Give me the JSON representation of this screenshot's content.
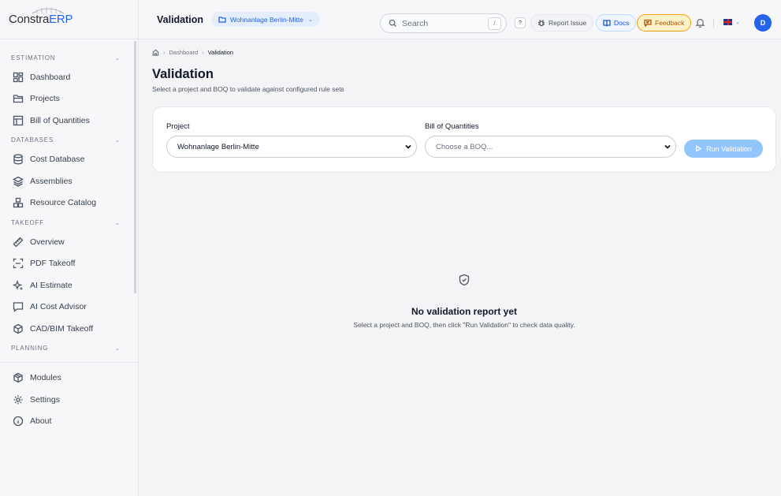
{
  "app": {
    "logo_main": "Constra",
    "logo_accent": "ERP"
  },
  "sidebar": {
    "sections": [
      {
        "label": "ESTIMATION",
        "items": [
          {
            "label": "Dashboard",
            "icon": "dashboard-icon"
          },
          {
            "label": "Projects",
            "icon": "folder-icon"
          },
          {
            "label": "Bill of Quantities",
            "icon": "table-icon"
          }
        ]
      },
      {
        "label": "DATABASES",
        "items": [
          {
            "label": "Cost Database",
            "icon": "database-icon"
          },
          {
            "label": "Assemblies",
            "icon": "layers-icon"
          },
          {
            "label": "Resource Catalog",
            "icon": "boxes-icon"
          }
        ]
      },
      {
        "label": "TAKEOFF",
        "items": [
          {
            "label": "Overview",
            "icon": "ruler-icon"
          },
          {
            "label": "PDF Takeoff",
            "icon": "scan-icon"
          },
          {
            "label": "AI Estimate",
            "icon": "sparkles-icon"
          },
          {
            "label": "AI Cost Advisor",
            "icon": "chat-icon"
          },
          {
            "label": "CAD/BIM Takeoff",
            "icon": "cube-icon"
          }
        ]
      },
      {
        "label": "PLANNING"
      }
    ],
    "bottom": [
      {
        "label": "Modules",
        "icon": "package-icon"
      },
      {
        "label": "Settings",
        "icon": "gear-icon"
      },
      {
        "label": "About",
        "icon": "info-icon"
      }
    ]
  },
  "topbar": {
    "page": "Validation",
    "project_chip": "Wohnanlage Berlin-Mitte",
    "search_placeholder": "Search",
    "search_kbd": "/",
    "help": "?",
    "report_issue": "Report Issue",
    "docs": "Docs",
    "feedback": "Feedback",
    "avatar": "D"
  },
  "breadcrumb": {
    "home_icon": "home-icon",
    "items": [
      "Dashboard",
      "Validation"
    ]
  },
  "page": {
    "title": "Validation",
    "subtitle": "Select a project and BOQ to validate against configured rule sets"
  },
  "form": {
    "project_label": "Project",
    "project_value": "Wohnanlage Berlin-Mitte",
    "boq_label": "Bill of Quantities",
    "boq_placeholder": "Choose a BOQ...",
    "run_button": "Run Validation"
  },
  "empty_state": {
    "title": "No validation report yet",
    "message": "Select a project and BOQ, then click \"Run Validation\" to check data quality."
  },
  "colors": {
    "accent": "#2563eb",
    "run_disabled": "#93c5fd",
    "feedback": "#f59e0b"
  }
}
